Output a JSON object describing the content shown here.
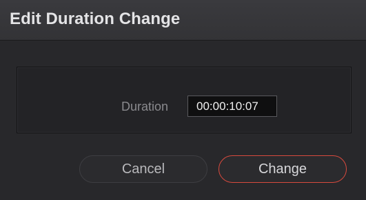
{
  "dialog": {
    "title": "Edit Duration Change",
    "duration": {
      "label": "Duration",
      "value": "00:00:10:07"
    },
    "buttons": {
      "cancel_label": "Cancel",
      "change_label": "Change"
    },
    "colors": {
      "accent_border": "#d94a3e",
      "background": "#28282b",
      "titlebar": "#353538"
    }
  }
}
